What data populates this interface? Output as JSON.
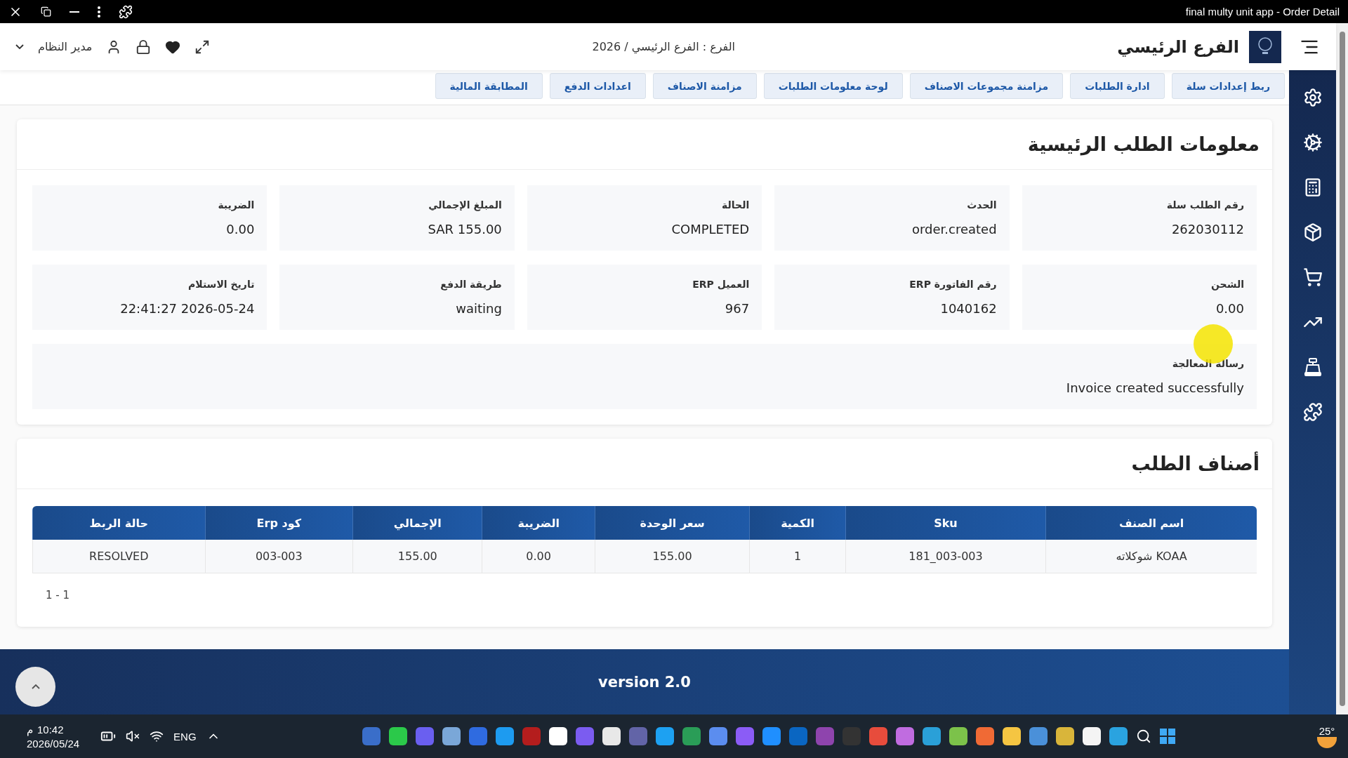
{
  "window": {
    "title": "final multy unit app - Order Detail"
  },
  "header": {
    "brand": "الفرع الرئيسي",
    "breadcrumb": "الفرع : الفرع الرئيسي / 2026",
    "user": "مدير النظام"
  },
  "tabs": [
    "ربط إعدادات سلة",
    "ادارة الطلبات",
    "مزامنة مجموعات الاصناف",
    "لوحة معلومات الطلبات",
    "مزامنة الاصناف",
    "اعدادات الدفع",
    "المطابقة المالية"
  ],
  "order_info": {
    "title": "معلومات الطلب الرئيسية",
    "fields": [
      {
        "label": "رقم الطلب سلة",
        "value": "262030112"
      },
      {
        "label": "الحدث",
        "value": "order.created"
      },
      {
        "label": "الحالة",
        "value": "COMPLETED"
      },
      {
        "label": "المبلغ الإجمالي",
        "value": "SAR 155.00"
      },
      {
        "label": "الضريبة",
        "value": "0.00"
      },
      {
        "label": "الشحن",
        "value": "0.00"
      },
      {
        "label": "رقم الفاتورة ERP",
        "value": "1040162"
      },
      {
        "label": "العميل ERP",
        "value": "967"
      },
      {
        "label": "طريقة الدفع",
        "value": "waiting"
      },
      {
        "label": "تاريخ الاستلام",
        "value": "2026-05-24 22:41:27"
      }
    ],
    "message": {
      "label": "رسالة المعالجة",
      "value": "Invoice created successfully"
    }
  },
  "items": {
    "title": "أصناف الطلب",
    "columns": [
      "اسم الصنف",
      "Sku",
      "الكمية",
      "سعر الوحدة",
      "الضريبة",
      "الإجمالي",
      "كود Erp",
      "حالة الربط"
    ],
    "rows": [
      [
        "شوكلاته KOAA",
        "181_003-003",
        "1",
        "155.00",
        "0.00",
        "155.00",
        "003-003",
        "RESOLVED"
      ]
    ],
    "pagination": "1 - 1"
  },
  "footer": {
    "version": "version 2.0"
  },
  "taskbar": {
    "time": "10:42",
    "period": "م",
    "date": "2026/05/24",
    "language": "ENG",
    "weather": "25°"
  }
}
